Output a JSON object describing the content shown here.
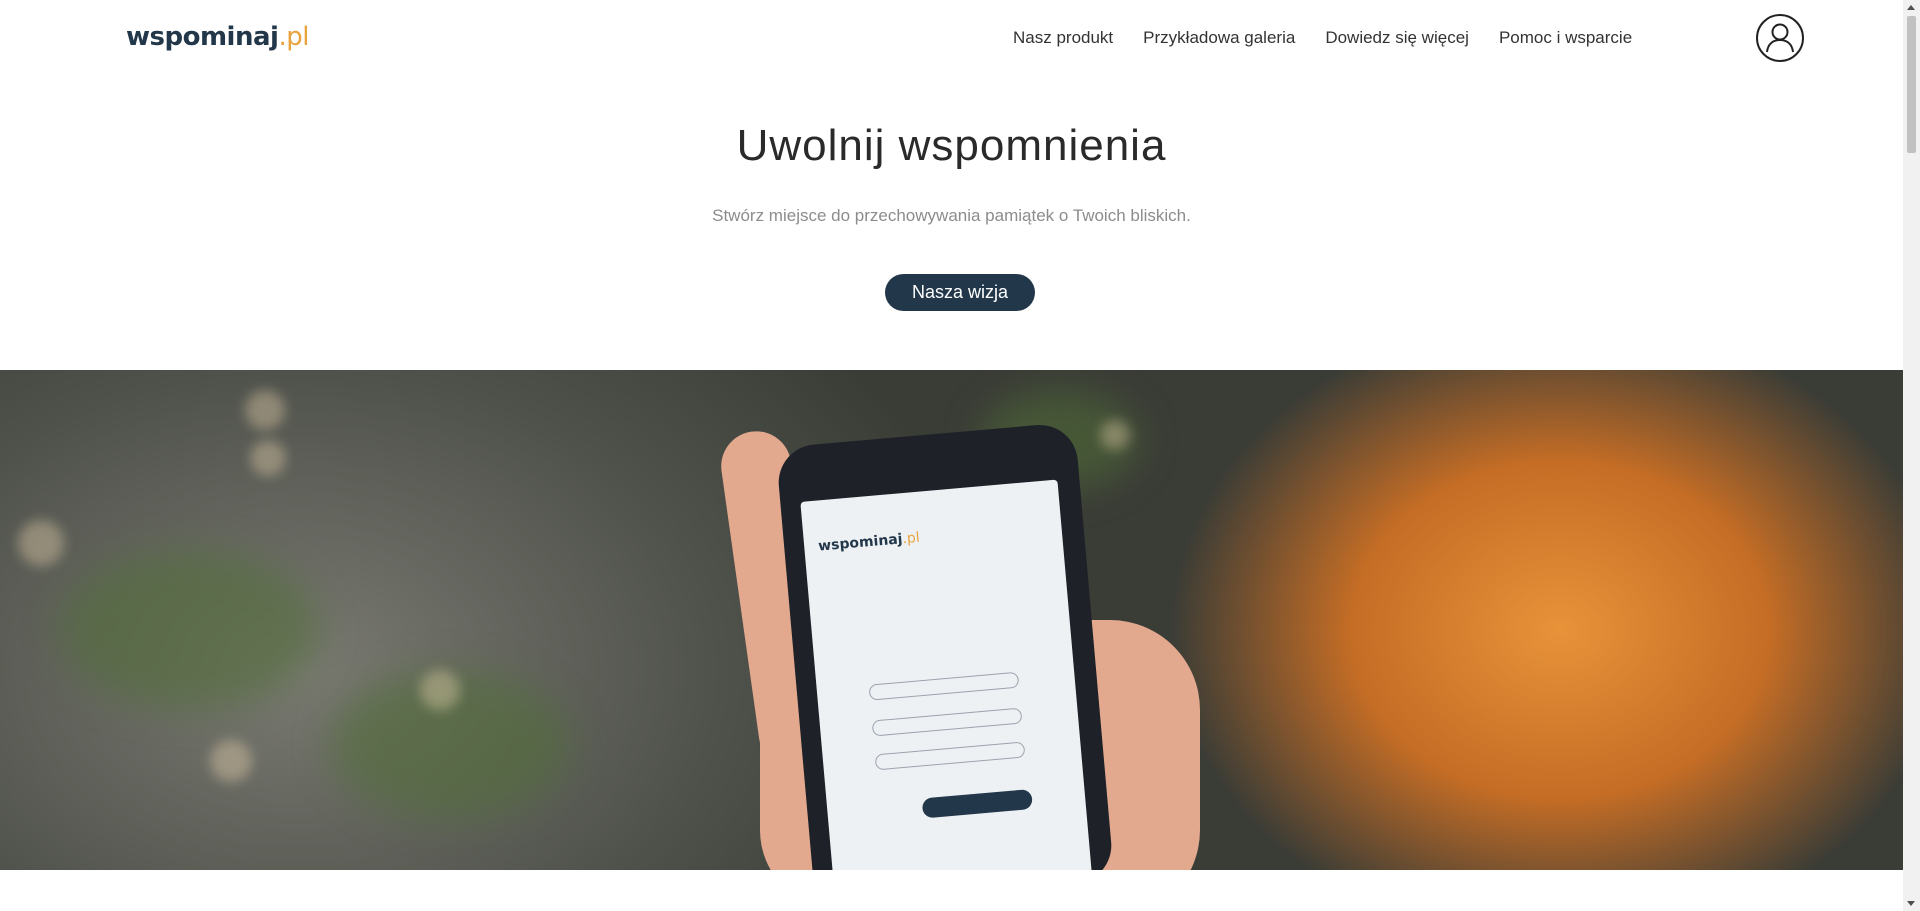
{
  "header": {
    "logo_main": "wspominaj",
    "logo_suffix": ".pl",
    "nav": [
      {
        "label": "Nasz produkt"
      },
      {
        "label": "Przykładowa galeria"
      },
      {
        "label": "Dowiedz się więcej"
      },
      {
        "label": "Pomoc i wsparcie"
      }
    ],
    "account_icon": "user-account-icon"
  },
  "hero": {
    "title": "Uwolnij wspomnienia",
    "subtitle": "Stwórz miejsce do przechowywania pamiątek o Twoich bliskich.",
    "cta_label": "Nasza wizja"
  },
  "colors": {
    "brand_navy": "#23374a",
    "brand_orange": "#e8a33d",
    "subtitle_gray": "#8c8c8c"
  }
}
